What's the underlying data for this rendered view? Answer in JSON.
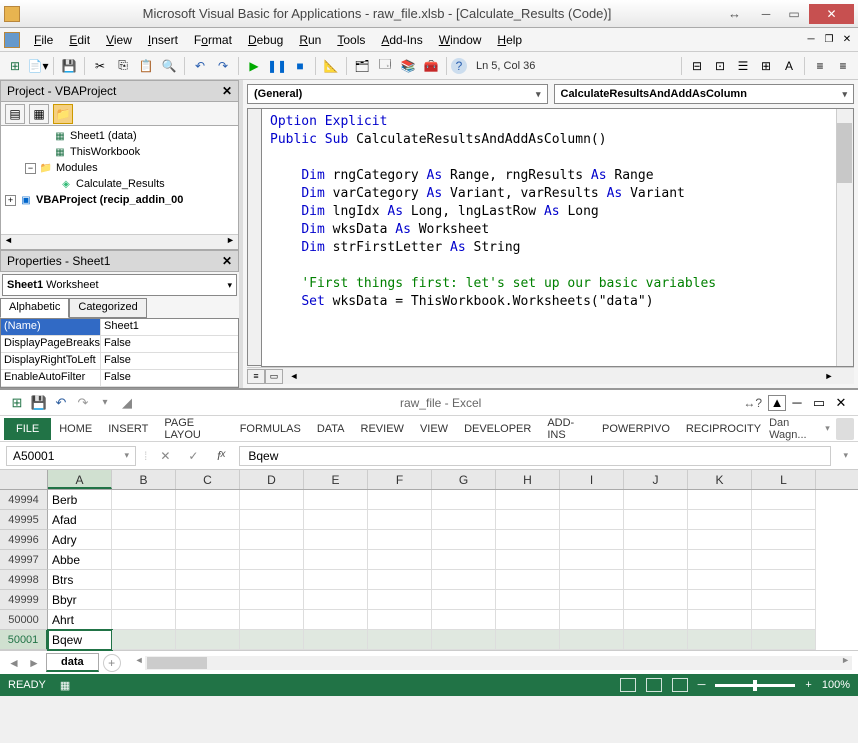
{
  "vba": {
    "title": "Microsoft Visual Basic for Applications - raw_file.xlsb - [Calculate_Results (Code)]",
    "menu": [
      "File",
      "Edit",
      "View",
      "Insert",
      "Format",
      "Debug",
      "Run",
      "Tools",
      "Add-Ins",
      "Window",
      "Help"
    ],
    "cursor_pos": "Ln 5, Col 36",
    "project_title": "Project - VBAProject",
    "tree": {
      "sheet1": "Sheet1 (data)",
      "thiswb": "ThisWorkbook",
      "modules": "Modules",
      "calc": "Calculate_Results",
      "addin": "VBAProject (recip_addin_00"
    },
    "props": {
      "title": "Properties - Sheet1",
      "object": "Sheet1",
      "object_type": "Worksheet",
      "tabs": [
        "Alphabetic",
        "Categorized"
      ],
      "rows": [
        {
          "k": "(Name)",
          "v": "Sheet1",
          "sel": true
        },
        {
          "k": "DisplayPageBreaks",
          "v": "False"
        },
        {
          "k": "DisplayRightToLeft",
          "v": "False"
        },
        {
          "k": "EnableAutoFilter",
          "v": "False"
        }
      ]
    },
    "combos": {
      "left": "(General)",
      "right": "CalculateResultsAndAddAsColumn"
    },
    "code": {
      "l1a": "Option Explicit",
      "l2a": "Public Sub ",
      "l2b": "CalculateResultsAndAddAsColumn()",
      "l3a": "Dim ",
      "l3b": "rngCategory ",
      "l3c": "As ",
      "l3d": "Range, rngResults ",
      "l3e": "As ",
      "l3f": "Range",
      "l4a": "Dim ",
      "l4b": "varCategory ",
      "l4c": "As ",
      "l4d": "Variant, varResults ",
      "l4e": "As ",
      "l4f": "Variant",
      "l5a": "Dim ",
      "l5b": "lngIdx ",
      "l5c": "As ",
      "l5d": "Long, lngLastRow ",
      "l5e": "As ",
      "l5f": "Long",
      "l6a": "Dim ",
      "l6b": "wksData ",
      "l6c": "As ",
      "l6d": "Worksheet",
      "l7a": "Dim ",
      "l7b": "strFirstLetter ",
      "l7c": "As ",
      "l7d": "String",
      "l8": "'First things first: let's set up our basic variables",
      "l9a": "Set ",
      "l9b": "wksData = ThisWorkbook.Worksheets(\"data\")"
    }
  },
  "excel": {
    "title": "raw_file - Excel",
    "ribbon": [
      "HOME",
      "INSERT",
      "PAGE LAYOU",
      "FORMULAS",
      "DATA",
      "REVIEW",
      "VIEW",
      "DEVELOPER",
      "ADD-INS",
      "POWERPIVO",
      "RECIPROCITY"
    ],
    "file_tab": "FILE",
    "user": "Dan Wagn...",
    "namebox": "A50001",
    "formula": "Bqew",
    "cols": [
      "A",
      "B",
      "C",
      "D",
      "E",
      "F",
      "G",
      "H",
      "I",
      "J",
      "K",
      "L"
    ],
    "rows": [
      {
        "n": "49994",
        "v": "Berb"
      },
      {
        "n": "49995",
        "v": "Afad"
      },
      {
        "n": "49996",
        "v": "Adry"
      },
      {
        "n": "49997",
        "v": "Abbe"
      },
      {
        "n": "49998",
        "v": "Btrs"
      },
      {
        "n": "49999",
        "v": "Bbyr"
      },
      {
        "n": "50000",
        "v": "Ahrt"
      },
      {
        "n": "50001",
        "v": "Bqew",
        "sel": true
      }
    ],
    "sheet_tab": "data",
    "status": "READY",
    "zoom": "100%"
  }
}
